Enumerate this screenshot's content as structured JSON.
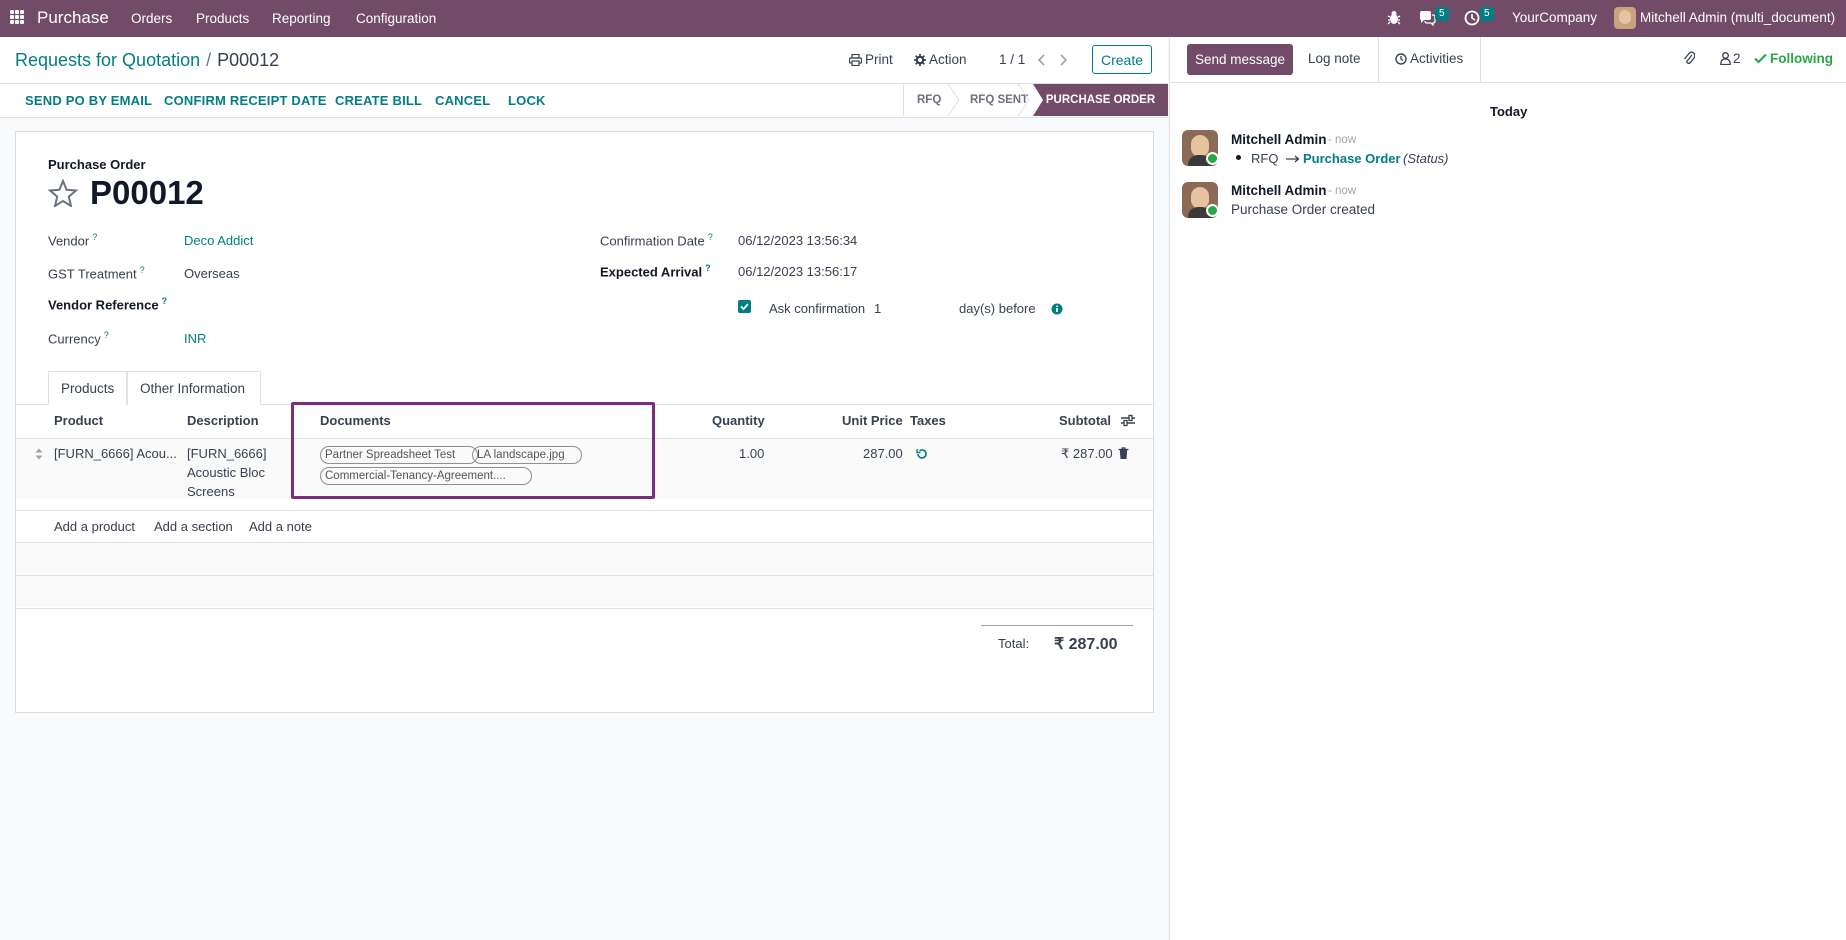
{
  "topbar": {
    "app_name": "Purchase",
    "menus": [
      "Orders",
      "Products",
      "Reporting",
      "Configuration"
    ],
    "messages_badge": "5",
    "activities_badge": "5",
    "company": "YourCompany",
    "user": "Mitchell Admin (multi_document)"
  },
  "breadcrumb": {
    "parent": "Requests for Quotation",
    "separator": "/",
    "current": "P00012"
  },
  "control": {
    "print": "Print",
    "action": "Action",
    "pager": "1 / 1",
    "create": "Create"
  },
  "actions": [
    "SEND PO BY EMAIL",
    "CONFIRM RECEIPT DATE",
    "CREATE BILL",
    "CANCEL",
    "LOCK"
  ],
  "stages": {
    "rfq": "RFQ",
    "rfq_sent": "RFQ SENT",
    "purchase_order": "PURCHASE ORDER"
  },
  "form": {
    "type_label": "Purchase Order",
    "name": "P00012",
    "vendor_label": "Vendor",
    "vendor": "Deco Addict",
    "gst_label": "GST Treatment",
    "gst": "Overseas",
    "vendor_ref_label": "Vendor Reference",
    "currency_label": "Currency",
    "currency": "INR",
    "confirmation_date_label": "Confirmation Date",
    "confirmation_date": "06/12/2023 13:56:34",
    "expected_arrival_label": "Expected Arrival",
    "expected_arrival": "06/12/2023 13:56:17",
    "ask_confirmation_label": "Ask confirmation",
    "ask_confirmation_days": "1",
    "days_before": "day(s) before",
    "help_mark": "?"
  },
  "tabs": [
    "Products",
    "Other Information"
  ],
  "table": {
    "headers": {
      "product": "Product",
      "description": "Description",
      "documents": "Documents",
      "quantity": "Quantity",
      "unit_price": "Unit Price",
      "taxes": "Taxes",
      "subtotal": "Subtotal"
    },
    "row": {
      "product": "[FURN_6666] Acou...",
      "description_lines": [
        "[FURN_6666]",
        "Acoustic Bloc",
        "Screens"
      ],
      "documents": [
        "Partner Spreadsheet Test",
        "LA landscape.jpg",
        "Commercial-Tenancy-Agreement...."
      ],
      "quantity": "1.00",
      "unit_price": "287.00",
      "subtotal": "₹ 287.00"
    },
    "add_product": "Add a product",
    "add_section": "Add a section",
    "add_note": "Add a note"
  },
  "totals": {
    "label": "Total:",
    "value": "₹ 287.00"
  },
  "chatter": {
    "send_message": "Send message",
    "log_note": "Log note",
    "activities": "Activities",
    "followers_count": "2",
    "following": "Following",
    "today": "Today",
    "messages": [
      {
        "author": "Mitchell Admin",
        "time": "- now",
        "from": "RFQ",
        "to": "Purchase Order",
        "field": "(Status)"
      },
      {
        "author": "Mitchell Admin",
        "time": "- now",
        "body": "Purchase Order created"
      }
    ]
  },
  "colors": {
    "brand": "#714b67",
    "accent": "#017e84",
    "highlight": "#7a2f7e"
  }
}
